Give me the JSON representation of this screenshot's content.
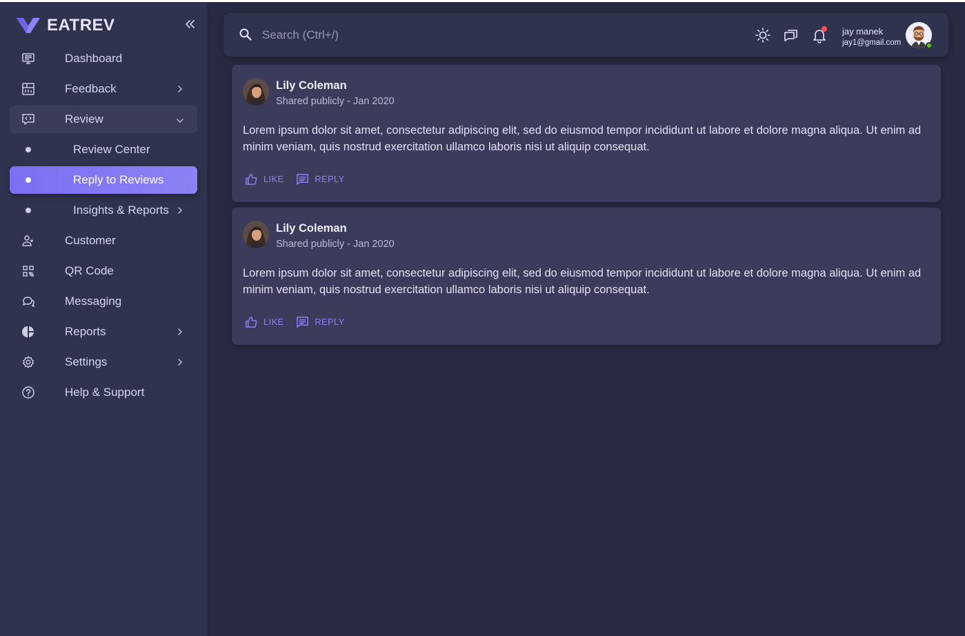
{
  "brand": {
    "name": "EATREV",
    "collapse_icon": "double-chevron-left-icon"
  },
  "colors": {
    "accent": "#8c82f7",
    "sidebar_bg": "#30334e",
    "page_bg": "#282a42",
    "card_bg": "#3b3c5b",
    "online": "#56ca00",
    "notification": "#ff4c51"
  },
  "sidebar": {
    "items": [
      {
        "label": "Dashboard",
        "icon": "monitor-icon"
      },
      {
        "label": "Feedback",
        "icon": "feedback-chart-icon"
      },
      {
        "label": "Review",
        "icon": "code-chat-icon"
      },
      {
        "label": "Review Center"
      },
      {
        "label": "Reply to Reviews"
      },
      {
        "label": "Insights & Reports"
      },
      {
        "label": "Customer",
        "icon": "user-plus-icon"
      },
      {
        "label": "QR Code",
        "icon": "qr-code-icon"
      },
      {
        "label": "Messaging",
        "icon": "chat-bubbles-icon"
      },
      {
        "label": "Reports",
        "icon": "pie-chart-icon"
      },
      {
        "label": "Settings",
        "icon": "gear-icon"
      },
      {
        "label": "Help & Support",
        "icon": "help-circle-icon"
      }
    ]
  },
  "topbar": {
    "search_placeholder": "Search (Ctrl+/)",
    "user": {
      "name": "jay manek",
      "email": "jay1@gmail.com"
    }
  },
  "reviews": [
    {
      "name": "Lily Coleman",
      "meta": "Shared publicly - Jan 2020",
      "body": "Lorem ipsum dolor sit amet, consectetur adipiscing elit, sed do eiusmod tempor incididunt ut labore et dolore magna aliqua. Ut enim ad minim veniam, quis nostrud exercitation ullamco laboris nisi ut aliquip consequat.",
      "like_label": "LIKE",
      "reply_label": "REPLY"
    },
    {
      "name": "Lily Coleman",
      "meta": "Shared publicly - Jan 2020",
      "body": "Lorem ipsum dolor sit amet, consectetur adipiscing elit, sed do eiusmod tempor incididunt ut labore et dolore magna aliqua. Ut enim ad minim veniam, quis nostrud exercitation ullamco laboris nisi ut aliquip consequat.",
      "like_label": "LIKE",
      "reply_label": "REPLY"
    }
  ]
}
